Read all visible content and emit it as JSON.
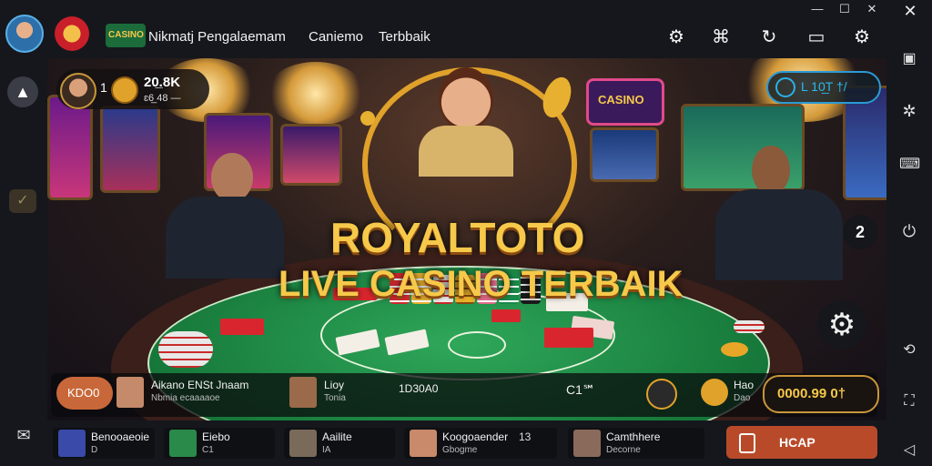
{
  "header": {
    "title": "Nikmatj Pengalaemam",
    "menu": [
      "Caniemo",
      "Terbbaik"
    ],
    "logo_text": "CASINO"
  },
  "window_controls": {
    "minimize": "—",
    "maximize": "☐",
    "close": "✕"
  },
  "balance_chip": {
    "level": "1",
    "amount": "20̲.8K",
    "sub": "ɛ6̲ 48 —"
  },
  "timer_pill": {
    "label": "L 10̲T †/"
  },
  "notification_count": "2",
  "hero": {
    "line1": "ROYALTOTO",
    "line2": "LIVE CASINO TERBAIK",
    "sign_text": "CASINO"
  },
  "info_bar": {
    "left_button": "KDO0",
    "player1_name": "Aikano ENSt Jnaam",
    "player1_sub": "Nbmia ecaaaaoe",
    "player2_name": "Lioy",
    "player2_sub": "Tonia",
    "code": "1D30A0",
    "count": "C1℠",
    "coin_label": "Hao",
    "coin_sub": "Dao",
    "amount": "0000.99 0†"
  },
  "players": [
    {
      "name": "Benooaeoie",
      "sub": "D"
    },
    {
      "name": "Eiebo",
      "sub": "C1"
    },
    {
      "name": "Aailite",
      "sub": "IA"
    },
    {
      "name": "Koogoaender",
      "sub": "Gbogme",
      "tag": "13"
    },
    {
      "name": "Camthhere",
      "sub": "Decorne"
    }
  ],
  "cta_button": {
    "label": "HCAP"
  },
  "colors": {
    "accent": "#f7c94a",
    "felt": "#1e8a45",
    "cta": "#b84a2a",
    "pill": "#2a9bd6"
  }
}
